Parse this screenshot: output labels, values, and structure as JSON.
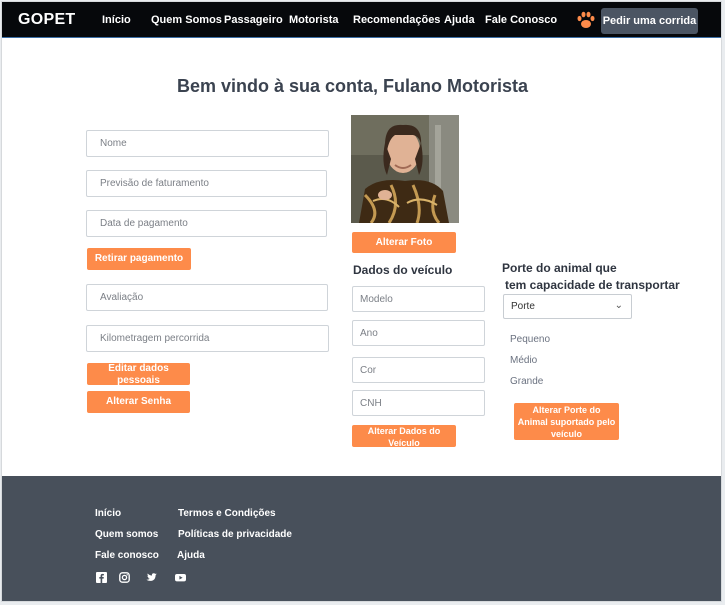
{
  "nav": {
    "brand": "GOPET",
    "links": [
      "Início",
      "Quem Somos",
      "Passageiro",
      "Motorista",
      "Recomendações",
      "Ajuda",
      "Fale Conosco"
    ],
    "cta": "Pedir uma corrida",
    "paw_icon": "paw-icon",
    "accent": "#fd8b4a"
  },
  "welcome": "Bem vindo à sua conta, Fulano Motorista",
  "personal": {
    "name_placeholder": "Nome",
    "billing_placeholder": "Previsão de faturamento",
    "paydate_placeholder": "Data de pagamento",
    "withdraw_label": "Retirar pagamento",
    "rating_placeholder": "Avaliação",
    "km_placeholder": "Kilometragem percorrida",
    "edit_label": "Editar dados pessoais",
    "password_label": "Alterar Senha"
  },
  "photo": {
    "change_label": "Alterar Foto"
  },
  "vehicle": {
    "title": "Dados do veículo",
    "model_placeholder": "Modelo",
    "year_placeholder": "Ano",
    "color_placeholder": "Cor",
    "cnh_placeholder": "CNH",
    "update_label": "Alterar Dados do Veículo"
  },
  "animal": {
    "title_line1": "Porte do animal que",
    "title_line2": "tem capacidade de transportar",
    "select_value": "Porte",
    "options": [
      "Pequeno",
      "Médio",
      "Grande"
    ],
    "update_label": "Alterar Porte do Animal suportado pelo veículo"
  },
  "footer": {
    "col1": [
      "Início",
      "Quem somos",
      "Fale conosco"
    ],
    "col2": [
      "Termos e Condições",
      "Políticas de privacidade",
      "Ajuda"
    ],
    "social_icons": [
      "facebook-icon",
      "instagram-icon",
      "twitter-icon",
      "youtube-icon"
    ],
    "background": "#48505b"
  }
}
